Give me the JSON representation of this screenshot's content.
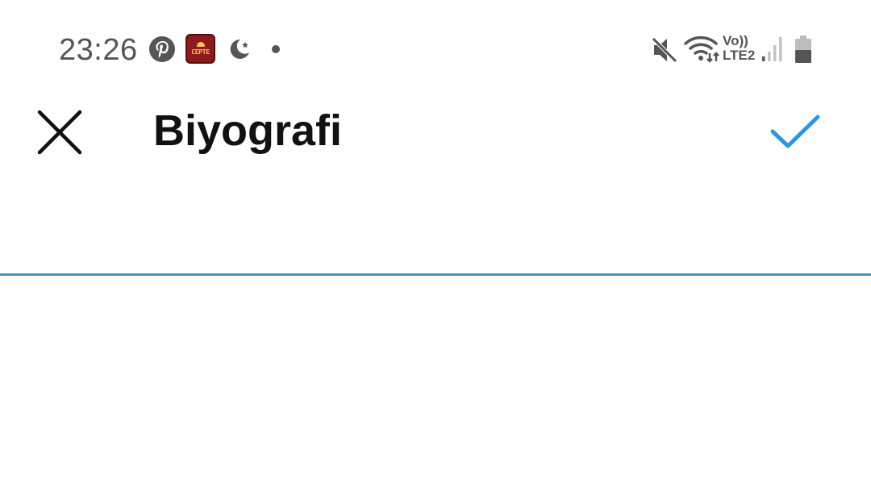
{
  "status_bar": {
    "time": "23:26",
    "notification_icons": [
      "pinterest-icon",
      "app-badge-icon",
      "moon-icon",
      "dot-icon"
    ],
    "app_badge_text": "CEPTE",
    "system_icons": [
      "mute-icon",
      "wifi-icon",
      "volte-lte-indicator",
      "signal-icon",
      "battery-icon"
    ],
    "volte_line1": "Vo))",
    "volte_line2": "LTE2"
  },
  "app_bar": {
    "close_icon": "close-icon",
    "title": "Biyografi",
    "confirm_icon": "check-icon"
  },
  "bio_field": {
    "value": "",
    "placeholder": ""
  },
  "colors": {
    "accent": "#2f95dc",
    "underline": "#4a93c1",
    "title_text": "#111111",
    "status_text": "#555555",
    "app_badge_bg": "#8e1b1b"
  }
}
